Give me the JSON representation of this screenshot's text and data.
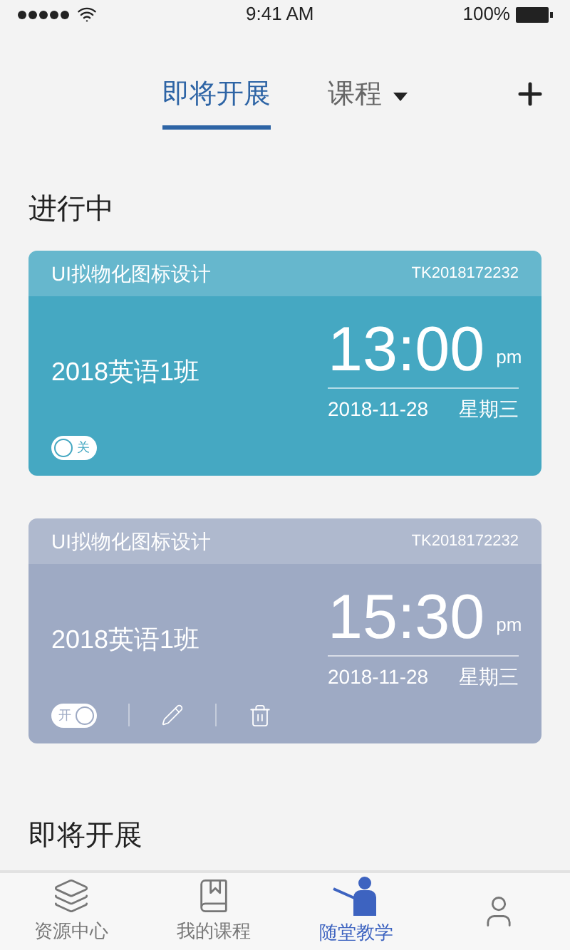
{
  "status_bar": {
    "time": "9:41 AM",
    "battery": "100%"
  },
  "tabs": [
    {
      "label": "即将开展",
      "selected": true,
      "dropdown": false
    },
    {
      "label": "课程",
      "selected": false,
      "dropdown": true
    }
  ],
  "sections": [
    {
      "title": "进行中"
    }
  ],
  "cards": [
    {
      "course": "UI拟物化图标设计",
      "code": "TK2018172232",
      "class_name": "2018英语1班",
      "time": "13:00",
      "meridiem": "pm",
      "date": "2018-11-28",
      "weekday": "星期三",
      "color": "#45a8c2",
      "switch": {
        "on": false,
        "label": "关"
      },
      "actions": false
    },
    {
      "course": "UI拟物化图标设计",
      "code": "TK2018172232",
      "class_name": "2018英语1班",
      "time": "15:30",
      "meridiem": "pm",
      "date": "2018-11-28",
      "weekday": "星期三",
      "color": "#9eaac4",
      "switch": {
        "on": true,
        "label": "开"
      },
      "actions": true
    }
  ],
  "next_section": {
    "title": "即将开展"
  },
  "bottom_nav": [
    {
      "label": "资源中心",
      "kind": "layers",
      "selected": false
    },
    {
      "label": "我的课程",
      "kind": "book",
      "selected": false
    },
    {
      "label": "随堂教学",
      "kind": "teacher",
      "selected": true
    },
    {
      "kind": "user",
      "selected": false
    }
  ]
}
